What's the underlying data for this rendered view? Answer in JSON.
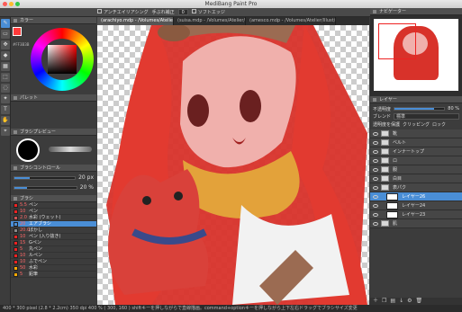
{
  "window": {
    "title": "MediBang Paint Pro"
  },
  "optionbar": {
    "antialias": "アンチエイリアシング",
    "correction_label": "手ぶれ補正",
    "correction_value": "0",
    "soft_edge": "ソフトエッジ"
  },
  "tabs": [
    "(arachiyo.mdp - /Volumes/Atelier/Illust/Phot...",
    "(suisa.mdp - /Volumes/Atelier/Illust/Phot...",
    "(amesco.mdp - /Volumes/Atelier/Illust/Phot..."
  ],
  "left": {
    "color_title": "カラー",
    "color_hex": "#FF3B3B",
    "palette_title": "パレット",
    "brush_preview_title": "ブラシプレビュー",
    "brush_control_title": "ブラシコントロール",
    "brush_size": "20 px",
    "brush_opacity": "20 %",
    "brush_size_frac": 0.25,
    "brush_opacity_frac": 0.2,
    "brush_title": "ブラシ",
    "brushes": [
      {
        "size": "5.5",
        "name": "ペン",
        "color": "#e22"
      },
      {
        "size": "10",
        "name": "ペン",
        "color": "#e22"
      },
      {
        "size": "2.0",
        "name": "水彩 (ウェット)",
        "color": "#c55"
      },
      {
        "size": "20",
        "name": "エアブラシ",
        "color": "#4a8ed6",
        "selected": true
      },
      {
        "size": "20.0",
        "name": "ぼかし",
        "color": "#888"
      },
      {
        "size": "10",
        "name": "ペン (入り抜き)",
        "color": "#e22"
      },
      {
        "size": "15",
        "name": "Gペン",
        "color": "#e22"
      },
      {
        "size": "5",
        "name": "丸ペン",
        "color": "#e22"
      },
      {
        "size": "10",
        "name": "ルペン",
        "color": "#e22"
      },
      {
        "size": "10",
        "name": "ふでペン",
        "color": "#e22"
      },
      {
        "size": "50",
        "name": "水彩",
        "color": "#fa0"
      },
      {
        "size": "5",
        "name": "鉛筆",
        "color": "#fa0"
      }
    ]
  },
  "right": {
    "navigator_title": "ナビゲーター",
    "layer_title": "レイヤー",
    "opacity_label": "不透明度",
    "opacity_value": "80 %",
    "opacity_frac": 0.8,
    "blend_label": "ブレンド",
    "blend_value": "標準",
    "protect_label": "透明度を保護",
    "clipping_label": "クリッピング",
    "lock_label": "ロック",
    "layers": [
      {
        "name": "靴",
        "type": "folder"
      },
      {
        "name": "ベルト",
        "type": "folder"
      },
      {
        "name": "インナートップ",
        "type": "folder"
      },
      {
        "name": "ロ",
        "type": "folder"
      },
      {
        "name": "服",
        "type": "folder"
      },
      {
        "name": "白目",
        "type": "folder"
      },
      {
        "name": "表パク",
        "type": "folder"
      },
      {
        "name": "レイヤー26",
        "type": "layer",
        "selected": true
      },
      {
        "name": "レイヤー24",
        "type": "layer"
      },
      {
        "name": "レイヤー23",
        "type": "layer"
      },
      {
        "name": "肌",
        "type": "folder"
      }
    ]
  },
  "status": "400 * 300 pixel  (2.8 * 2.2cm)  350 dpi  400 %  ( 300, 160 )  shiftキーを押しながらで直線描画。command+optionキーを押しながら上下左右ドラッグでブラシサイズ変更"
}
